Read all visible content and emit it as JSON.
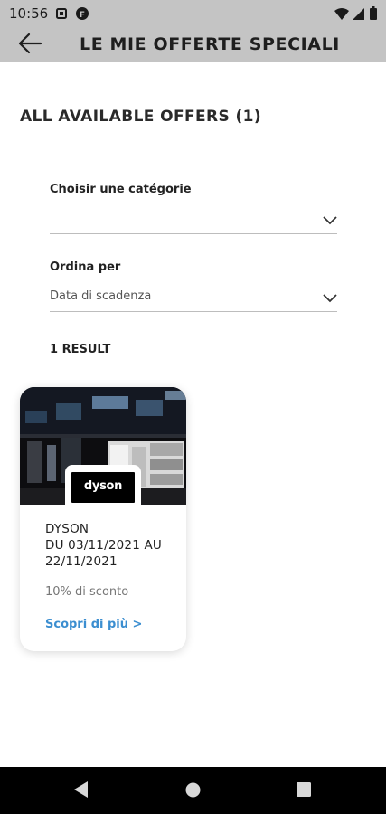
{
  "status_bar": {
    "time": "10:56",
    "left_icons": [
      "square-notification-icon",
      "f-app-notification-icon"
    ],
    "right_icons": [
      "wifi-icon",
      "signal-icon",
      "battery-icon"
    ]
  },
  "app_bar": {
    "title": "LE MIE OFFERTE SPECIALI",
    "back_icon": "arrow-left-icon"
  },
  "section_title": "ALL AVAILABLE OFFERS (1)",
  "filters": {
    "category": {
      "label": "Choisir une catégorie",
      "value": ""
    },
    "sort": {
      "label": "Ordina per",
      "value": "Data di scadenza"
    }
  },
  "result_count": "1 RESULT",
  "offers": [
    {
      "brand_logo": "dyson",
      "title_lines": [
        "DYSON",
        "DU 03/11/2021 AU",
        "22/11/2021"
      ],
      "discount": "10% di sconto",
      "link": "Scopri di più >"
    }
  ],
  "colors": {
    "top_band": "#c4c4c4",
    "link": "#3b8ed0",
    "nav_bar": "#000000"
  },
  "nav_bar": [
    "back-triangle-icon",
    "home-circle-icon",
    "recents-square-icon"
  ]
}
